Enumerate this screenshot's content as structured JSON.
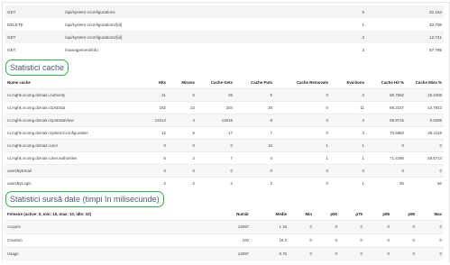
{
  "http_requests": [
    {
      "method": "GET",
      "path": "/api/system-cconfigurations",
      "count": "5",
      "time": "22.104"
    },
    {
      "method": "DELETE",
      "path": "/api/system-cconfigurations/{id}",
      "count": "1",
      "time": "40.708"
    },
    {
      "method": "GET",
      "path": "/api/system-cconfigurations/{id}",
      "count": "2",
      "time": "12.741"
    },
    {
      "method": "GET",
      "path": "/management/info",
      "count": "3",
      "time": "57.799"
    }
  ],
  "cache": {
    "title": "Statistici cache",
    "headers": [
      "Nume cache",
      "Hits",
      "Misses",
      "Cache Gets",
      "Cache Puts",
      "Cache Removals",
      "Evictions",
      "Cache Hit %",
      "Cache Miss %"
    ],
    "rows": [
      [
        "ro.mghk.vcomg.domain.Authority",
        "21",
        "5",
        "26",
        "5",
        "0",
        "2",
        "80.7692",
        "19.2308"
      ],
      [
        "ro.mghk.vcomg.domain.GpsData",
        "182",
        "22",
        "204",
        "28",
        "0",
        "11",
        "89.2157",
        "10.7843"
      ],
      [
        "ro.mghk.vcomg.domain.GpsDataView",
        "14012",
        "4",
        "14016",
        "8",
        "0",
        "3",
        "99.9715",
        "0.0285"
      ],
      [
        "ro.mghk.vcomg.domain.SystemCconfiguration",
        "12",
        "5",
        "17",
        "7",
        "0",
        "3",
        "70.5882",
        "29.4118"
      ],
      [
        "ro.mghk.vcomg.domain.User",
        "0",
        "0",
        "0",
        "10",
        "1",
        "1",
        "0",
        "0"
      ],
      [
        "ro.mghk.vcomg.domain.User.authorities",
        "5",
        "2",
        "7",
        "4",
        "1",
        "1",
        "71.4286",
        "28.5714"
      ],
      [
        "usersByEmail",
        "0",
        "0",
        "0",
        "0",
        "0",
        "0",
        "0",
        "0"
      ],
      [
        "usersByLogin",
        "2",
        "2",
        "4",
        "2",
        "0",
        "1",
        "50",
        "50"
      ]
    ]
  },
  "datasource": {
    "title": "Statistici sursă date (timpi în milisecunde)",
    "headers": [
      "Folosire (active: 0, min: 10, max: 10, idle: 10)",
      "Număr",
      "Medie",
      "Min",
      "p50",
      "p75",
      "p95",
      "p99",
      "Max"
    ],
    "rows": [
      [
        "Acquire",
        "14097",
        "1.18",
        "0",
        "0",
        "0",
        "0",
        "0",
        "0"
      ],
      [
        "Creation",
        "100",
        "18.3",
        "0",
        "0",
        "0",
        "0",
        "0",
        "0"
      ],
      [
        "Usage",
        "14097",
        "9.75",
        "0",
        "0",
        "0",
        "0",
        "0",
        "0"
      ]
    ]
  }
}
